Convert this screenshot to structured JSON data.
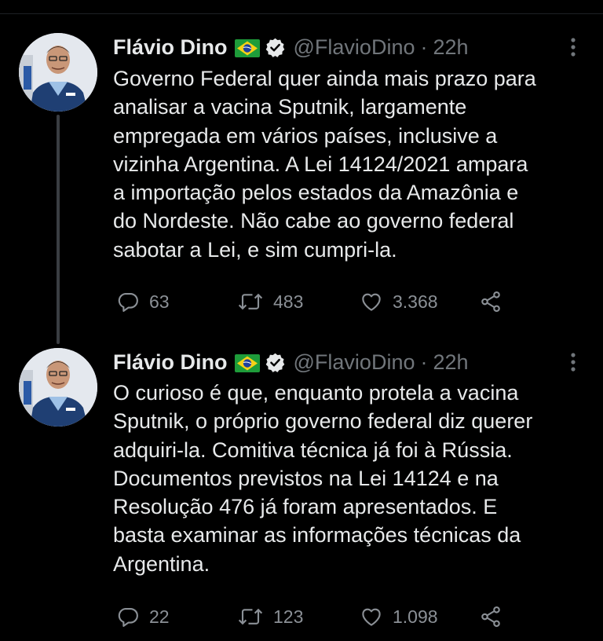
{
  "tweets": [
    {
      "name": "Flávio Dino",
      "handle": "@FlavioDino",
      "separator": "·",
      "time": "22h",
      "lines": [
        "Governo Federal quer ainda mais prazo para",
        "analisar a vacina Sputnik, largamente",
        "empregada em vários países, inclusive a",
        "vizinha Argentina. A Lei 14124/2021 ampara",
        "a importação pelos estados da Amazônia e",
        "do Nordeste. Não cabe ao governo federal",
        "sabotar a Lei, e sim cumpri-la."
      ],
      "replies": "63",
      "retweets": "483",
      "likes": "3.368"
    },
    {
      "name": "Flávio Dino",
      "handle": "@FlavioDino",
      "separator": "·",
      "time": "22h",
      "lines": [
        "O curioso é que, enquanto protela a vacina",
        "Sputnik, o próprio governo federal diz querer",
        "adquiri-la. Comitiva técnica já foi à Rússia.",
        "Documentos previstos na Lei 14124 e na",
        "Resolução 476 já foram apresentados. E",
        "basta examinar as informações técnicas da",
        "Argentina."
      ],
      "replies": "22",
      "retweets": "123",
      "likes": "1.098"
    }
  ],
  "icons": {
    "flag": "brazil-flag-icon",
    "verified": "verified-badge-icon",
    "more": "more-options-icon",
    "reply": "reply-icon",
    "retweet": "retweet-icon",
    "like": "like-icon",
    "share": "share-icon"
  },
  "colors": {
    "background": "#000000",
    "text": "#e7e9ea",
    "muted": "#71767b",
    "thread_line": "#3a3d42"
  }
}
